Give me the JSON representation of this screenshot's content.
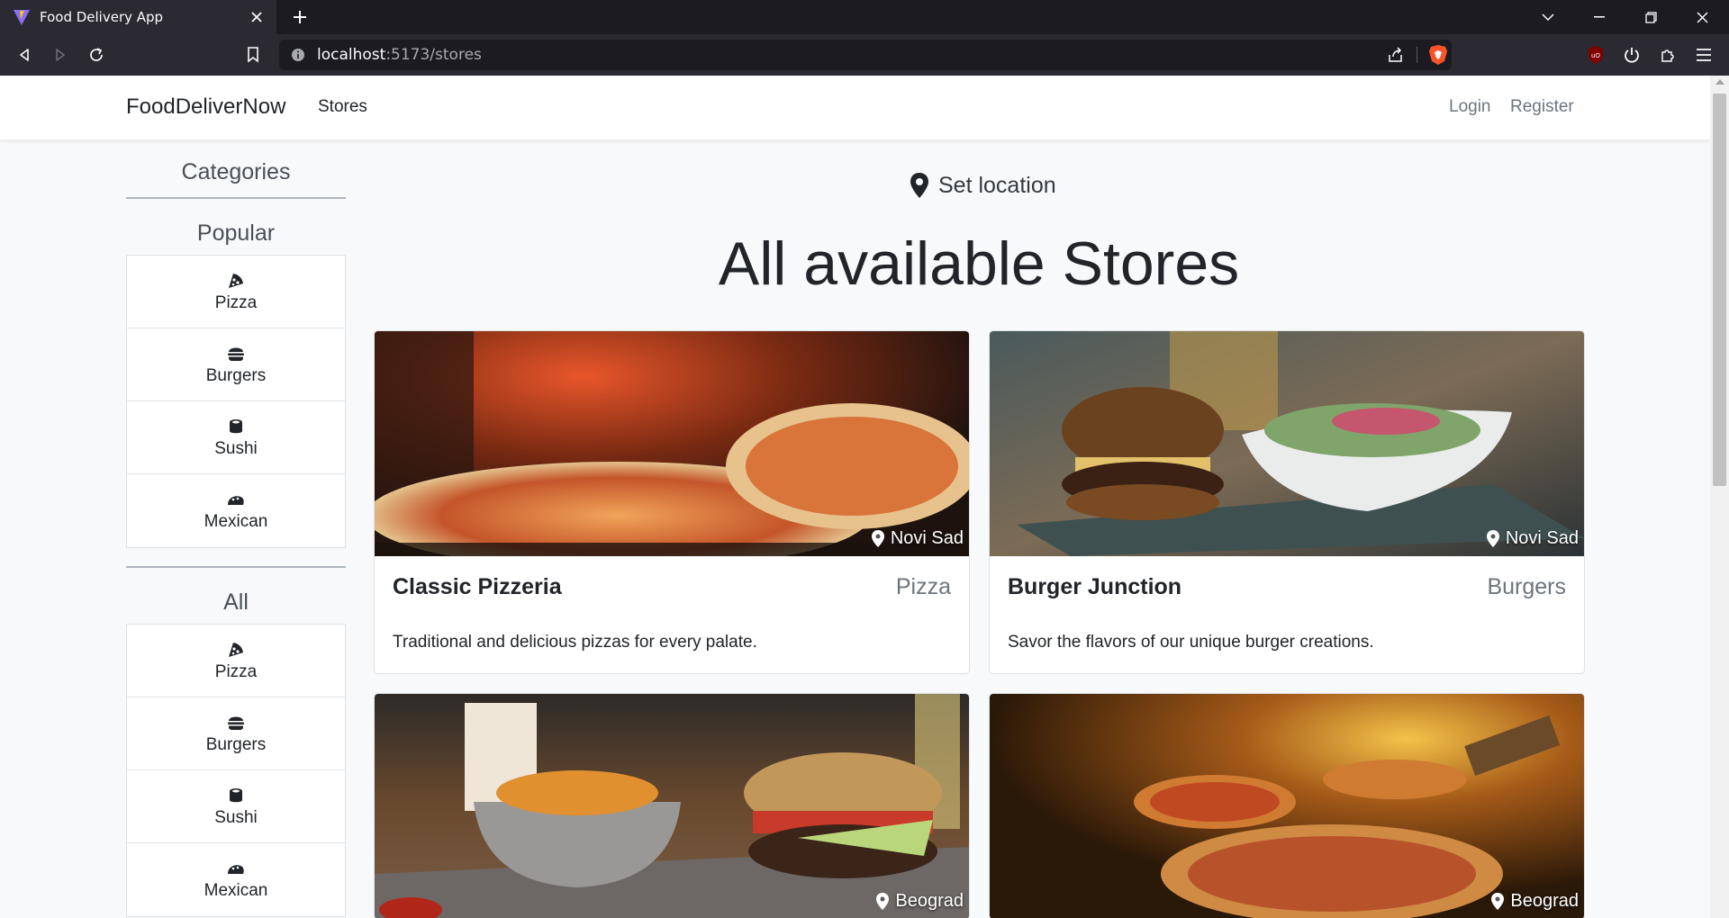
{
  "browser": {
    "tab_title": "Food Delivery App",
    "url_host": "localhost",
    "url_path": ":5173/stores"
  },
  "site": {
    "brand": "FoodDeliverNow",
    "nav_stores": "Stores",
    "nav_login": "Login",
    "nav_register": "Register"
  },
  "sidebar": {
    "heading": "Categories",
    "popular_heading": "Popular",
    "popular": [
      {
        "label": "Pizza",
        "icon": "pizza-icon"
      },
      {
        "label": "Burgers",
        "icon": "burger-icon"
      },
      {
        "label": "Sushi",
        "icon": "sushi-icon"
      },
      {
        "label": "Mexican",
        "icon": "taco-icon"
      }
    ],
    "all_heading": "All",
    "all": [
      {
        "label": "Pizza",
        "icon": "pizza-icon"
      },
      {
        "label": "Burgers",
        "icon": "burger-icon"
      },
      {
        "label": "Sushi",
        "icon": "sushi-icon"
      },
      {
        "label": "Mexican",
        "icon": "taco-icon"
      }
    ]
  },
  "main": {
    "set_location": "Set location",
    "title": "All available Stores",
    "stores": [
      {
        "name": "Classic Pizzeria",
        "category": "Pizza",
        "city": "Novi Sad",
        "description": "Traditional and delicious pizzas for every palate."
      },
      {
        "name": "Burger Junction",
        "category": "Burgers",
        "city": "Novi Sad",
        "description": "Savor the flavors of our unique burger creations."
      },
      {
        "name": "",
        "category": "",
        "city": "Beograd",
        "description": ""
      },
      {
        "name": "",
        "category": "",
        "city": "Beograd",
        "description": ""
      }
    ]
  },
  "colors": {
    "brave_orange": "#fb542b",
    "page_bg": "#f8f9fa",
    "muted_text": "#6c757d"
  }
}
